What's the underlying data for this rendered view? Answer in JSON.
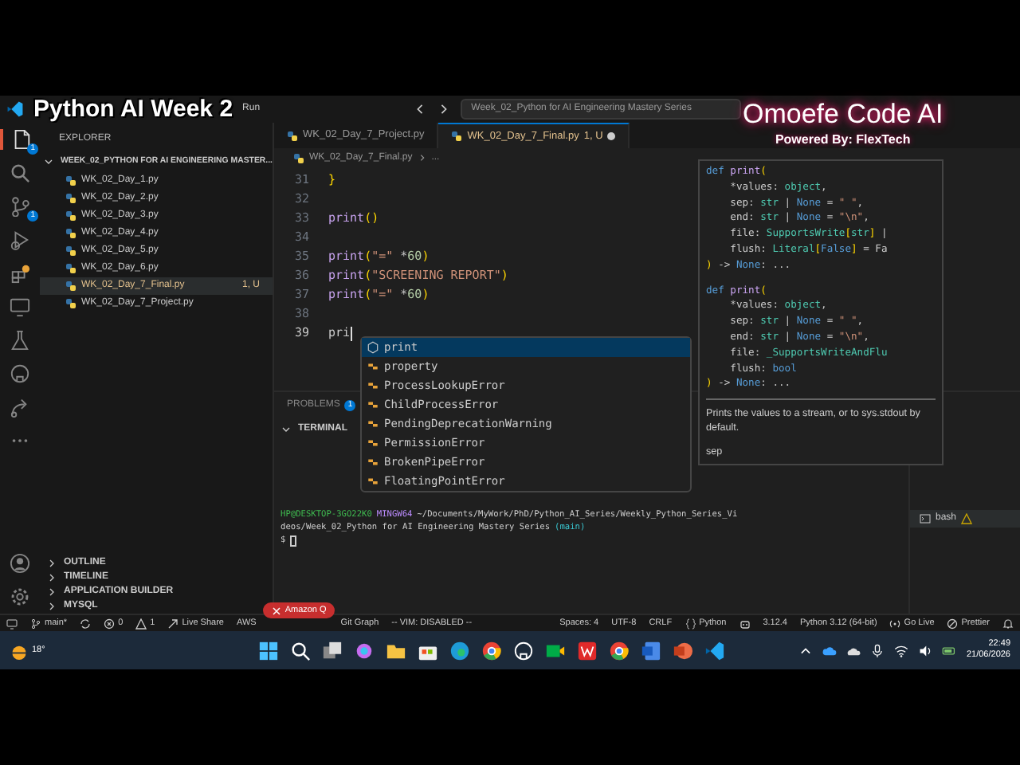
{
  "overlay_title": "Python AI Week 2",
  "brand_overlay": {
    "title": "Omoefe Code AI",
    "subtitle": "Powered By: FlexTech"
  },
  "title_bar": {
    "menu": "Run",
    "command_center": "Week_02_Python for AI Engineering Mastery Series"
  },
  "activity_bar": {
    "items": [
      {
        "kind": "files",
        "badge": "1",
        "selected": true
      },
      {
        "kind": "search",
        "selected": false
      },
      {
        "kind": "source-control",
        "badge": "1",
        "selected": false
      },
      {
        "kind": "run",
        "selected": false
      },
      {
        "kind": "extensions",
        "selected": false
      },
      {
        "kind": "remote",
        "selected": false
      },
      {
        "kind": "testing",
        "selected": false
      },
      {
        "kind": "github",
        "selected": false
      },
      {
        "kind": "share",
        "selected": false
      },
      {
        "kind": "more",
        "selected": false
      }
    ],
    "bottom": [
      {
        "kind": "account"
      },
      {
        "kind": "settings"
      }
    ]
  },
  "sidebar": {
    "title": "EXPLORER",
    "folder": "WEEK_02_PYTHON FOR AI ENGINEERING MASTER...",
    "files": [
      {
        "name": "WK_02_Day_1.py",
        "selected": false
      },
      {
        "name": "WK_02_Day_2.py",
        "selected": false
      },
      {
        "name": "WK_02_Day_3.py",
        "selected": false
      },
      {
        "name": "WK_02_Day_4.py",
        "selected": false
      },
      {
        "name": "WK_02_Day_5.py",
        "selected": false
      },
      {
        "name": "WK_02_Day_6.py",
        "selected": false
      },
      {
        "name": "WK_02_Day_7_Final.py",
        "selected": true,
        "status": "1, U"
      },
      {
        "name": "WK_02_Day_7_Project.py",
        "selected": false
      }
    ],
    "sections": [
      "OUTLINE",
      "TIMELINE",
      "APPLICATION BUILDER",
      "MYSQL"
    ]
  },
  "tabs": [
    {
      "label": "WK_02_Day_7_Project.py",
      "selected": false
    },
    {
      "label": "WK_02_Day_7_Final.py",
      "selected": true,
      "status": "1, U",
      "unsaved": true
    }
  ],
  "breadcrumb": [
    "WK_02_Day_7_Final.py",
    "..."
  ],
  "code": [
    {
      "number": "31",
      "text": "}"
    },
    {
      "number": "32"
    },
    {
      "number": "33",
      "text": "print()"
    },
    {
      "number": "34"
    },
    {
      "number": "35",
      "text": "print(\"=\" *60)"
    },
    {
      "number": "36",
      "text": "print(\"SCREENING REPORT\")"
    },
    {
      "number": "37",
      "text": "print(\"=\" *60)"
    },
    {
      "number": "38"
    },
    {
      "number": "39",
      "text": "pri",
      "current": true
    }
  ],
  "suggestions": [
    {
      "kind": "function",
      "label": "print",
      "selected": true
    },
    {
      "kind": "class",
      "label": "property",
      "selected": false
    },
    {
      "kind": "class",
      "label": "ProcessLookupError",
      "selected": false
    },
    {
      "kind": "class",
      "label": "ChildProcessError",
      "selected": false
    },
    {
      "kind": "class",
      "label": "PendingDeprecationWarning",
      "selected": false
    },
    {
      "kind": "class",
      "label": "PermissionError",
      "selected": false
    },
    {
      "kind": "class",
      "label": "BrokenPipeError",
      "selected": false
    },
    {
      "kind": "class",
      "label": "FloatingPointError",
      "selected": false
    }
  ],
  "hover": {
    "signature": [
      "def print(",
      "    *values: object,",
      "    sep: str | None = \" \",",
      "    end: str | None = \"\\n\",",
      "    file: SupportsWrite[str] |",
      "    flush: Literal[False] = Fa",
      ") -> None: ...",
      "def print(",
      "    *values: object,",
      "    sep: str | None = \" \",",
      "    end: str | None = \"\\n\",",
      "    file: _SupportsWriteAndFlu",
      "    flush: bool",
      ") -> None: ..."
    ],
    "doc": "Prints the values to a stream, or to sys.stdout by default.",
    "more": "sep"
  },
  "panel": {
    "problems": "PROBLEMS",
    "problems_count": "1",
    "terminal": "TERMINAL",
    "terminal_tab": "bash",
    "terminal_lines": [
      {
        "user": "HP@DESKTOP-3GO22K0",
        "shell": "MINGW64",
        "path": "~/Documents/MyWork/PhD/Python_AI_Series/Weekly_Python_Series_Vi"
      },
      {
        "path": "deos/Week_02_Python for AI Engineering Mastery Series",
        "branch": "(main)"
      },
      {
        "prompt": "$"
      }
    ]
  },
  "status_bar": {
    "left": [
      {
        "kind": "remote"
      },
      {
        "kind": "branch",
        "text": "main*"
      },
      {
        "kind": "sync"
      },
      {
        "kind": "error",
        "text": "0"
      },
      {
        "kind": "warning",
        "text": "1"
      },
      {
        "kind": "liveshare",
        "text": "Live Share"
      },
      {
        "kind": "plain",
        "text": "AWS"
      },
      {
        "kind": "close",
        "text": "Amazon Q",
        "alert": true
      },
      {
        "kind": "plain",
        "text": "Git Graph"
      },
      {
        "kind": "plain",
        "text": "-- VIM: DISABLED --"
      }
    ],
    "right": [
      {
        "kind": "plain",
        "text": "Spaces: 4"
      },
      {
        "kind": "plain",
        "text": "UTF-8"
      },
      {
        "kind": "plain",
        "text": "CRLF"
      },
      {
        "kind": "braces",
        "text": "Python"
      },
      {
        "kind": "robot"
      },
      {
        "kind": "plain",
        "text": "3.12.4"
      },
      {
        "kind": "plain",
        "text": "Python 3.12 (64-bit)"
      },
      {
        "kind": "radio",
        "text": "Go Live"
      },
      {
        "kind": "block",
        "text": "Prettier"
      },
      {
        "kind": "bell"
      }
    ]
  },
  "taskbar": {
    "weather": "18°",
    "time": "22:49",
    "date": "21/06/2026"
  }
}
